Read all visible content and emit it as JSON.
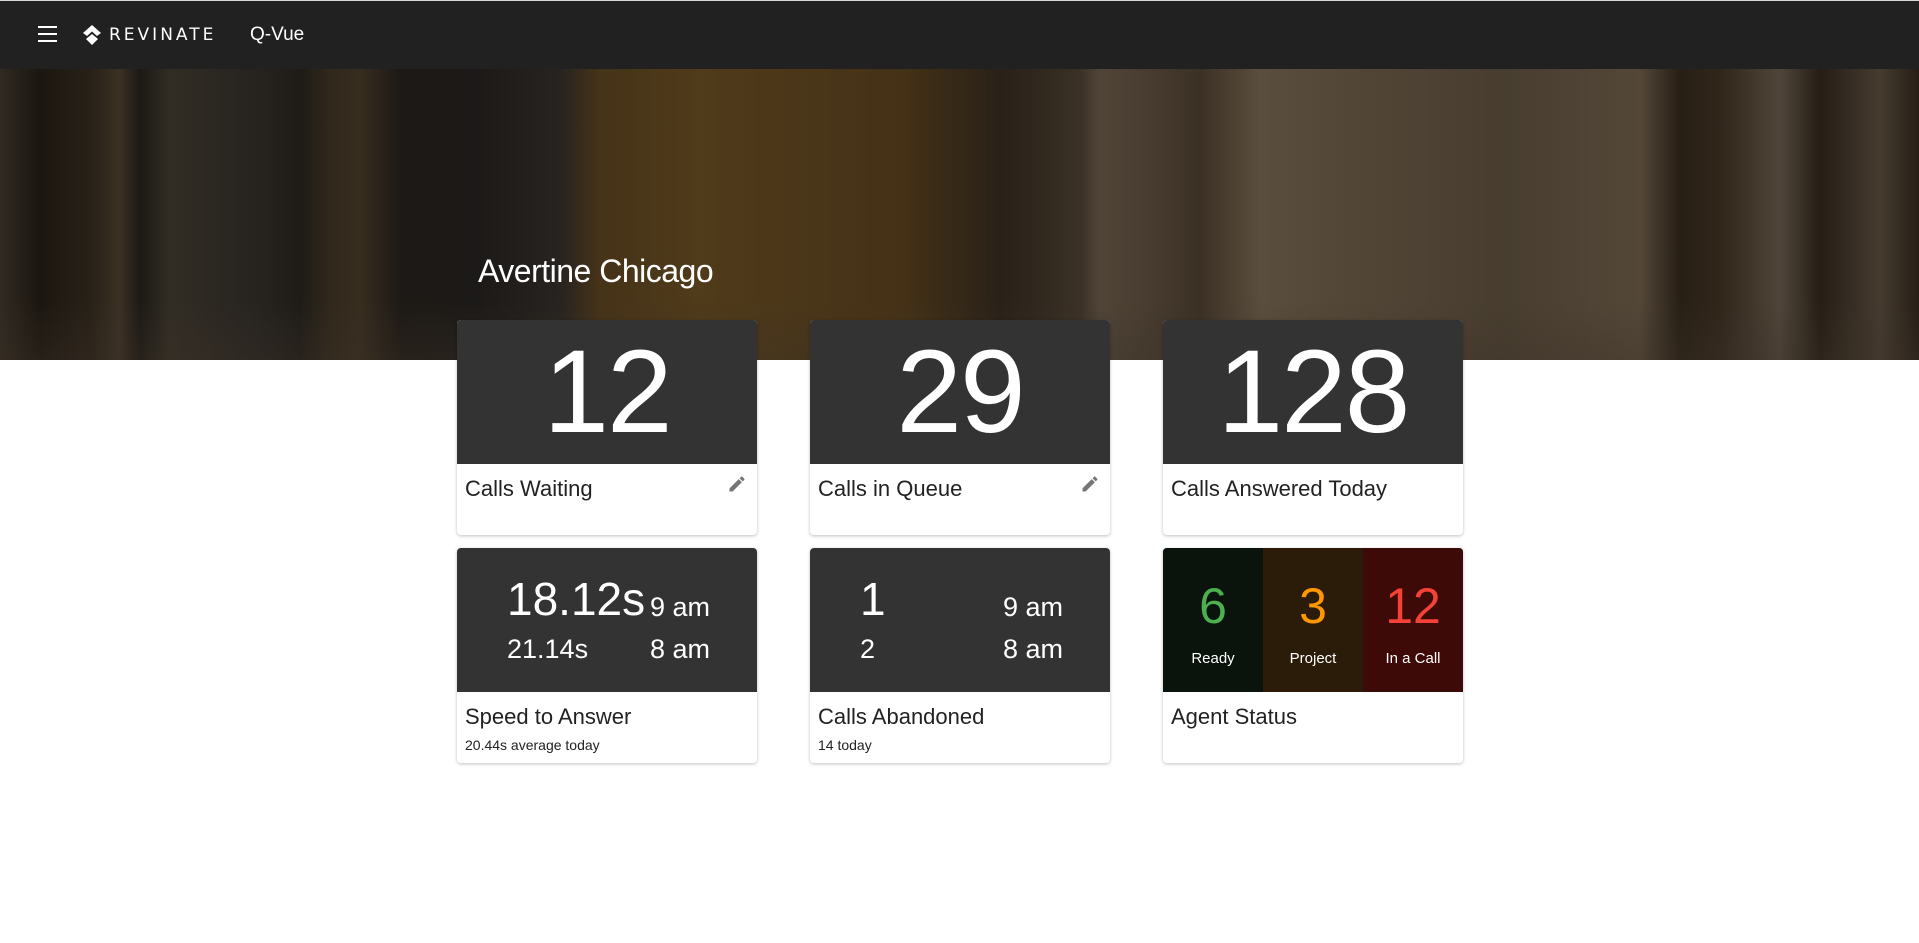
{
  "app": {
    "brand": "REVINATE",
    "name": "Q-Vue",
    "menu_icon": "hamburger-menu-icon",
    "logo_icon": "revinate-logo-icon"
  },
  "hero": {
    "title": "Avertine Chicago"
  },
  "cards": {
    "calls_waiting": {
      "value": "12",
      "title": "Calls Waiting",
      "edit_icon": "pencil-icon"
    },
    "calls_in_queue": {
      "value": "29",
      "title": "Calls in Queue",
      "edit_icon": "pencil-icon"
    },
    "calls_answered": {
      "value": "128",
      "title": "Calls Answered Today"
    },
    "speed_to_answer": {
      "current_value": "18.12s",
      "current_hour": "9 am",
      "previous_value": "21.14s",
      "previous_hour": "8 am",
      "title": "Speed to Answer",
      "subtitle": "20.44s average today"
    },
    "calls_abandoned": {
      "current_value": "1",
      "current_hour": "9 am",
      "previous_value": "2",
      "previous_hour": "8 am",
      "title": "Calls Abandoned",
      "subtitle": "14 today"
    },
    "agent_status": {
      "title": "Agent Status",
      "statuses": [
        {
          "count": "6",
          "label": "Ready",
          "color": "#4caf50",
          "bg": "#0a130c"
        },
        {
          "count": "3",
          "label": "Project",
          "color": "#ff9800",
          "bg": "#2b1b09"
        },
        {
          "count": "12",
          "label": "In a Call",
          "color": "#f44336",
          "bg": "#3d0a08"
        }
      ]
    }
  }
}
